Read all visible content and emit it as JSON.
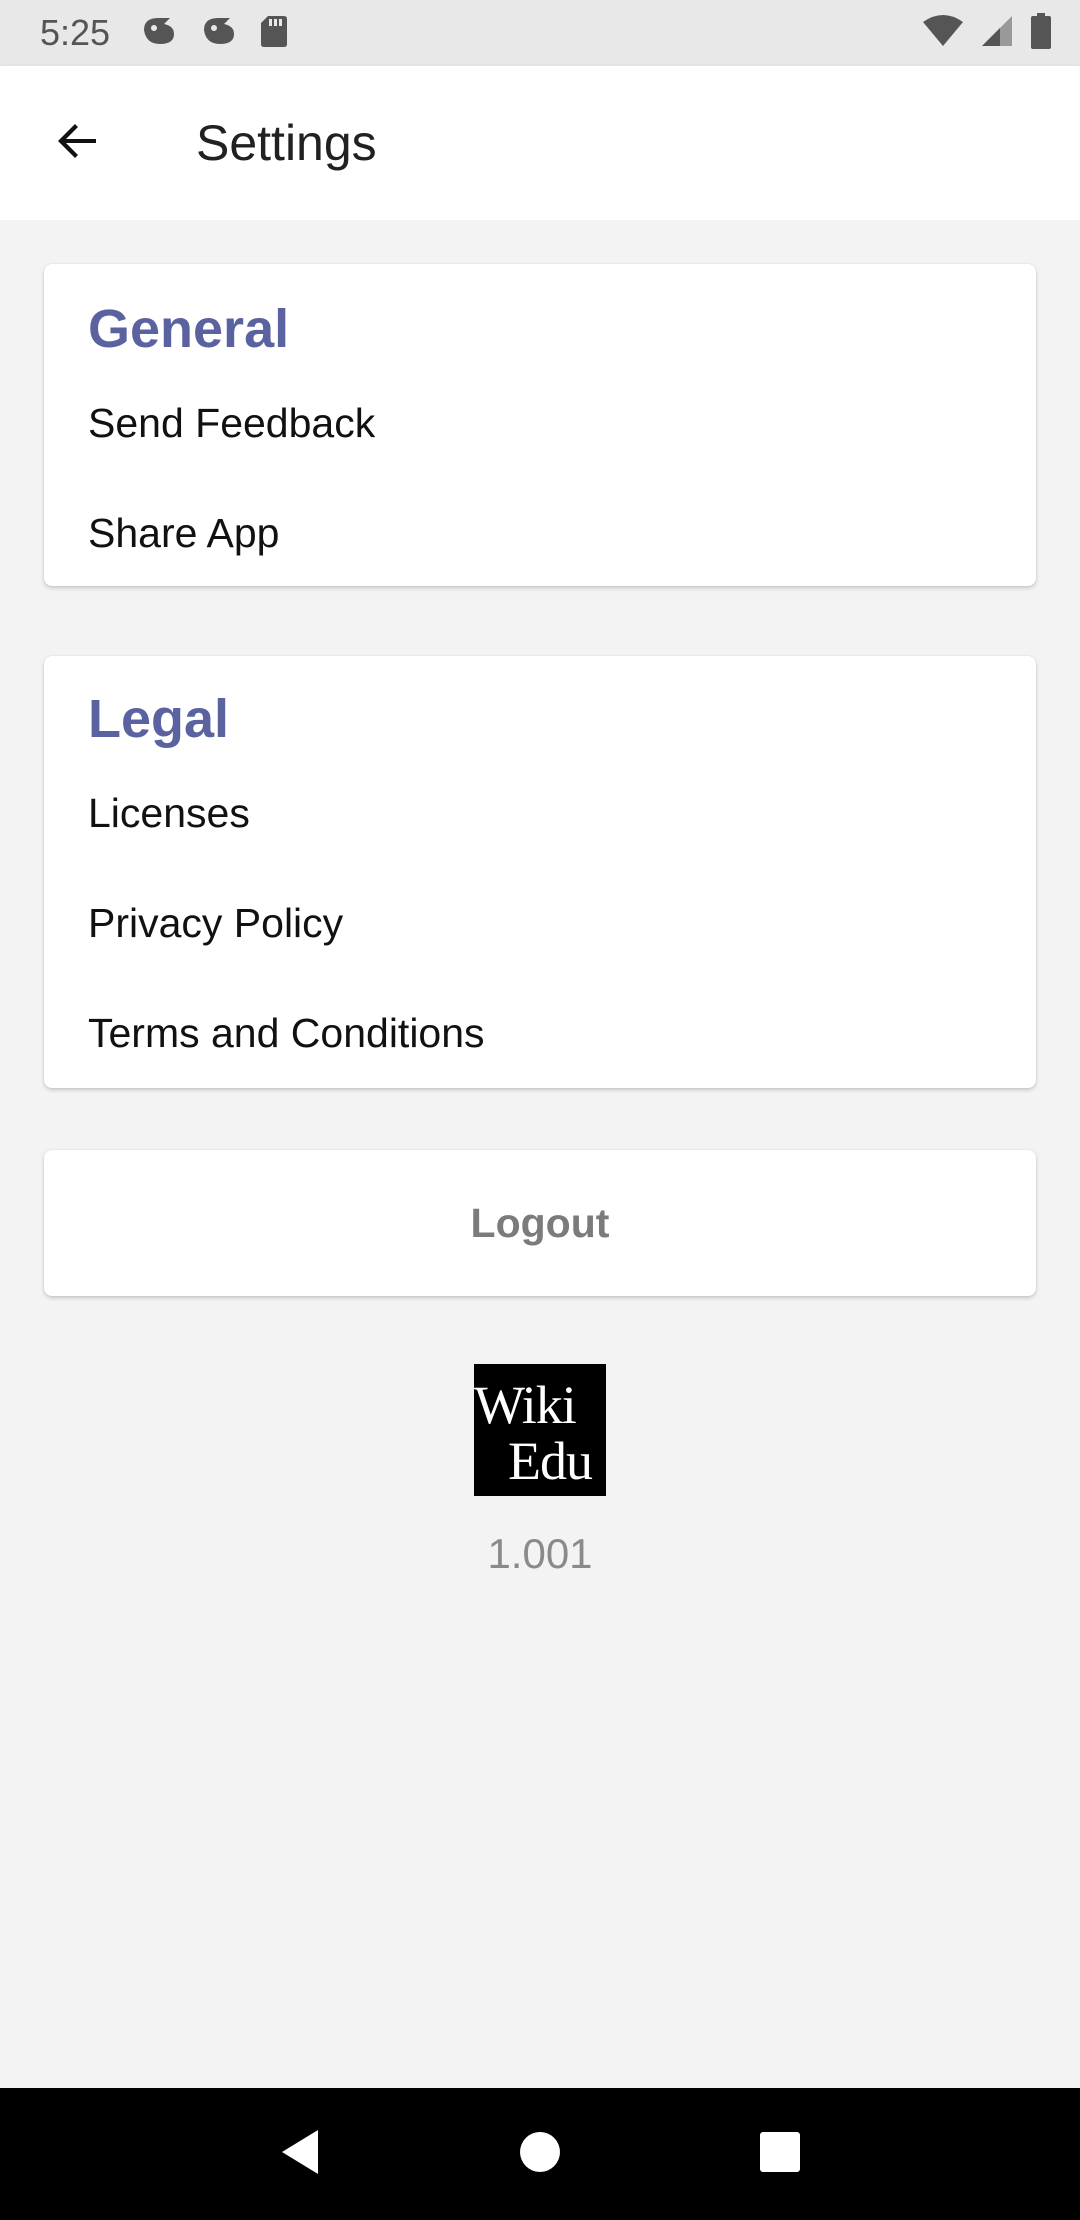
{
  "status_bar": {
    "time": "5:25",
    "left_icons": [
      "notification-icon",
      "notification-icon",
      "sd-card-icon"
    ],
    "right_icons": [
      "wifi-icon",
      "signal-icon",
      "battery-icon"
    ]
  },
  "app_bar": {
    "title": "Settings",
    "back_icon": "arrow-back-icon"
  },
  "sections": {
    "general": {
      "title": "General",
      "items": [
        "Send Feedback",
        "Share App"
      ]
    },
    "legal": {
      "title": "Legal",
      "items": [
        "Licenses",
        "Privacy Policy",
        "Terms and Conditions"
      ]
    }
  },
  "logout": {
    "label": "Logout"
  },
  "logo": {
    "line1": "Wiki",
    "line2": "Edu"
  },
  "version": "1.001",
  "nav_bar": {
    "icons": [
      "back-triangle-icon",
      "home-circle-icon",
      "recents-square-icon"
    ]
  },
  "colors": {
    "section_title": "#5a63a0",
    "background": "#f3f3f3",
    "logout_text": "#7b7b7b"
  }
}
